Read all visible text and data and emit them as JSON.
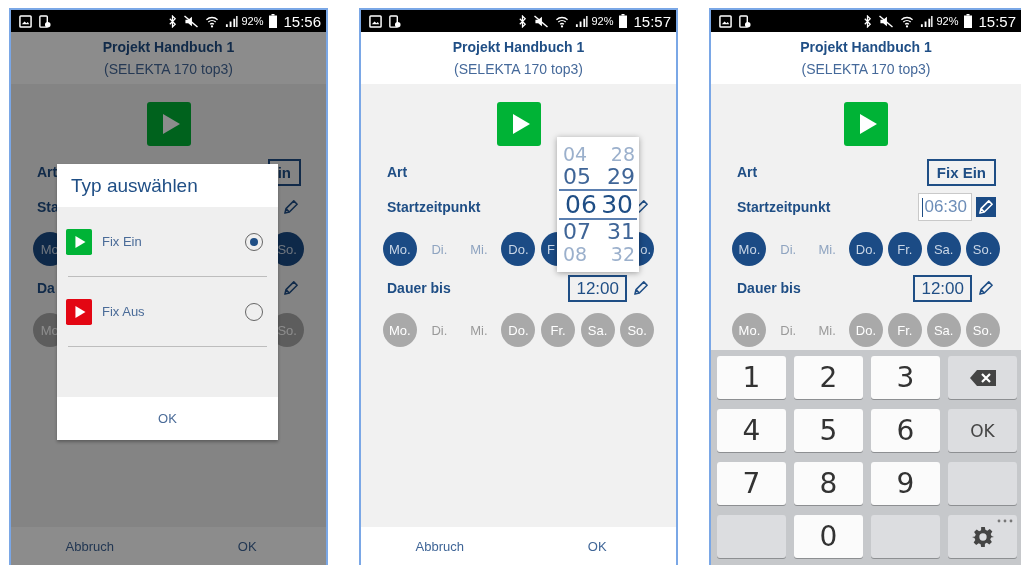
{
  "screens": [
    {
      "status_bar": {
        "battery": "92%",
        "time": "15:56"
      },
      "header": {
        "title": "Projekt Handbuch 1",
        "subtitle": "(SELEKTA 170 top3)"
      },
      "rows": [
        {
          "kind": "choice",
          "label": "Art",
          "value": "in"
        },
        {
          "kind": "time",
          "label": "Sta",
          "editing": false
        },
        {
          "kind": "days",
          "disabled": false,
          "days": [
            {
              "kind": "full",
              "label": "Mo",
              "selected": true
            },
            {
              "kind": "covered"
            },
            {
              "kind": "covered"
            },
            {
              "kind": "covered"
            },
            {
              "kind": "covered"
            },
            {
              "kind": "covered"
            },
            {
              "kind": "full",
              "label": "So.",
              "selected": true
            }
          ]
        },
        {
          "kind": "time",
          "label": "Da",
          "editing": false
        },
        {
          "kind": "days",
          "disabled": true,
          "days": [
            {
              "kind": "full",
              "label": "Mo",
              "selected": true
            },
            {
              "kind": "covered"
            },
            {
              "kind": "covered"
            },
            {
              "kind": "covered"
            },
            {
              "kind": "covered"
            },
            {
              "kind": "covered"
            },
            {
              "kind": "full",
              "label": "So.",
              "selected": true
            }
          ]
        }
      ],
      "footer": [
        "Abbruch",
        "OK"
      ],
      "overlay": {
        "kind": "dialog",
        "title": "Typ auswählen",
        "options": [
          {
            "label": "Fix Ein",
            "color": "#00b336",
            "selected": true
          },
          {
            "label": "Fix Aus",
            "color": "#e30613",
            "selected": false
          }
        ],
        "button": "OK"
      }
    },
    {
      "status_bar": {
        "battery": "92%",
        "time": "15:57"
      },
      "header": {
        "title": "Projekt Handbuch 1",
        "subtitle": "(SELEKTA 170 top3)"
      },
      "rows": [
        {
          "kind": "choice",
          "label": "Art"
        },
        {
          "kind": "time",
          "label": "Startzeitpunkt",
          "editing": false
        },
        {
          "kind": "days",
          "disabled": false,
          "days": [
            {
              "kind": "full",
              "label": "Mo.",
              "selected": true
            },
            {
              "kind": "full",
              "label": "Di.",
              "selected": false
            },
            {
              "kind": "full",
              "label": "Mi.",
              "selected": false
            },
            {
              "kind": "full",
              "label": "Do.",
              "selected": true
            },
            {
              "kind": "head",
              "label": "F",
              "selected": true
            },
            {
              "kind": "covered"
            },
            {
              "kind": "tail",
              "label": "o.",
              "selected": true
            }
          ]
        },
        {
          "kind": "time",
          "label": "Dauer bis",
          "value": "12:00",
          "editing": false
        },
        {
          "kind": "days",
          "disabled": true,
          "days": [
            {
              "kind": "full",
              "label": "Mo.",
              "selected": true
            },
            {
              "kind": "full",
              "label": "Di.",
              "selected": false
            },
            {
              "kind": "full",
              "label": "Mi.",
              "selected": false
            },
            {
              "kind": "full",
              "label": "Do.",
              "selected": true
            },
            {
              "kind": "full",
              "label": "Fr.",
              "selected": true
            },
            {
              "kind": "full",
              "label": "Sa.",
              "selected": true
            },
            {
              "kind": "full",
              "label": "So.",
              "selected": true
            }
          ]
        }
      ],
      "footer": [
        "Abbruch",
        "OK"
      ],
      "overlay": {
        "kind": "picker",
        "rows": [
          {
            "hour": "04",
            "minute": "28",
            "selected": false
          },
          {
            "hour": "05",
            "minute": "29",
            "selected": false
          },
          {
            "hour": "06",
            "minute": "30",
            "selected": true
          },
          {
            "hour": "07",
            "minute": "31",
            "selected": false
          },
          {
            "hour": "08",
            "minute": "32",
            "selected": false
          }
        ]
      }
    },
    {
      "status_bar": {
        "battery": "92%",
        "time": "15:57"
      },
      "header": {
        "title": "Projekt Handbuch 1",
        "subtitle": "(SELEKTA 170 top3)"
      },
      "rows": [
        {
          "kind": "choice",
          "label": "Art",
          "value": "Fix Ein"
        },
        {
          "kind": "time",
          "label": "Startzeitpunkt",
          "value": "06:30",
          "editing": true
        },
        {
          "kind": "days",
          "disabled": false,
          "days": [
            {
              "kind": "full",
              "label": "Mo.",
              "selected": true
            },
            {
              "kind": "full",
              "label": "Di.",
              "selected": false
            },
            {
              "kind": "full",
              "label": "Mi.",
              "selected": false
            },
            {
              "kind": "full",
              "label": "Do.",
              "selected": true
            },
            {
              "kind": "full",
              "label": "Fr.",
              "selected": true
            },
            {
              "kind": "full",
              "label": "Sa.",
              "selected": true
            },
            {
              "kind": "full",
              "label": "So.",
              "selected": true
            }
          ]
        },
        {
          "kind": "time",
          "label": "Dauer bis",
          "value": "12:00",
          "editing": false
        },
        {
          "kind": "days",
          "disabled": true,
          "days": [
            {
              "kind": "full",
              "label": "Mo.",
              "selected": true
            },
            {
              "kind": "full",
              "label": "Di.",
              "selected": false
            },
            {
              "kind": "full",
              "label": "Mi.",
              "selected": false
            },
            {
              "kind": "full",
              "label": "Do.",
              "selected": true
            },
            {
              "kind": "full",
              "label": "Fr.",
              "selected": true
            },
            {
              "kind": "full",
              "label": "Sa.",
              "selected": true
            },
            {
              "kind": "full",
              "label": "So.",
              "selected": true
            }
          ]
        }
      ],
      "overlay": {
        "kind": "keypad",
        "keys": [
          {
            "kind": "digit",
            "label": "1"
          },
          {
            "kind": "digit",
            "label": "2"
          },
          {
            "kind": "digit",
            "label": "3"
          },
          {
            "kind": "backspace"
          },
          {
            "kind": "digit",
            "label": "4"
          },
          {
            "kind": "digit",
            "label": "5"
          },
          {
            "kind": "digit",
            "label": "6"
          },
          {
            "kind": "action",
            "label": "OK"
          },
          {
            "kind": "digit",
            "label": "7"
          },
          {
            "kind": "digit",
            "label": "8"
          },
          {
            "kind": "digit",
            "label": "9"
          },
          {
            "kind": "blank"
          },
          {
            "kind": "blank"
          },
          {
            "kind": "digit",
            "label": "0"
          },
          {
            "kind": "blank"
          },
          {
            "kind": "settings"
          }
        ]
      }
    }
  ]
}
